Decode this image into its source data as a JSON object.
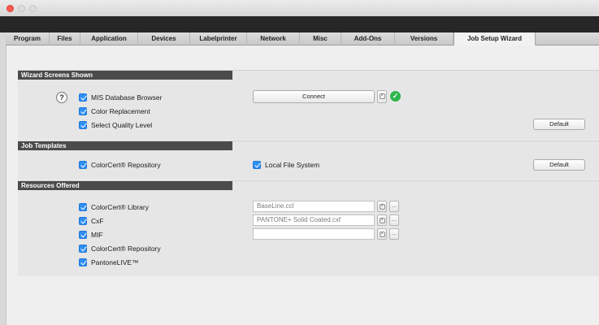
{
  "tabs": [
    {
      "label": "Program",
      "active": false
    },
    {
      "label": "Files",
      "active": false
    },
    {
      "label": "Application",
      "active": false
    },
    {
      "label": "Devices",
      "active": false
    },
    {
      "label": "Labelprinter",
      "active": false
    },
    {
      "label": "Network",
      "active": false
    },
    {
      "label": "Misc",
      "active": false
    },
    {
      "label": "Add-Ons",
      "active": false
    },
    {
      "label": "Versions",
      "active": false
    },
    {
      "label": "Job Setup Wizard",
      "active": true
    }
  ],
  "wizard": {
    "title": "Wizard Screens Shown",
    "help": "?",
    "items": [
      {
        "label": "MIS Database Browser",
        "checked": true
      },
      {
        "label": "Color Replacement",
        "checked": true
      },
      {
        "label": "Select Quality Level",
        "checked": true
      }
    ],
    "connect_label": "Connect",
    "default_label": "Default"
  },
  "templates": {
    "title": "Job Templates",
    "repository_label": "ColorCert® Repository",
    "local_label": "Local File System",
    "default_label": "Default"
  },
  "resources": {
    "title": "Resources Offered",
    "items": [
      {
        "label": "ColorCert® Library",
        "checked": true,
        "file": "BaseLine.ccl"
      },
      {
        "label": "CxF",
        "checked": true,
        "file": "PANTONE+ Solid Coated.cxf"
      },
      {
        "label": "MIF",
        "checked": true,
        "file": ""
      },
      {
        "label": "ColorCert® Repository",
        "checked": true
      },
      {
        "label": "PantoneLIVE™",
        "checked": true
      }
    ],
    "browse_label": "...",
    "clear_label": "×"
  },
  "icons": {
    "checkbox": "checkbox-checked",
    "status": "check-circle-icon",
    "clear": "clear-icon"
  },
  "colors": {
    "accent": "#2f8ff5",
    "success": "#2eb54c",
    "header": "#4b4b4b",
    "close": "#fd5a52"
  }
}
